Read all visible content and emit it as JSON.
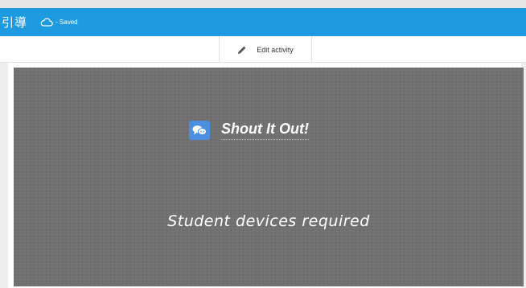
{
  "header": {
    "title": "引導",
    "save_status": "- Saved",
    "color": "#1e9be0"
  },
  "toolbar": {
    "edit_label": "Edit activity",
    "edit_icon": "pencil-icon"
  },
  "slide": {
    "activity_icon": "chat-bubbles-icon",
    "activity_title": "Shout It Out!",
    "notice": "Student devices required",
    "background": "#717171"
  }
}
